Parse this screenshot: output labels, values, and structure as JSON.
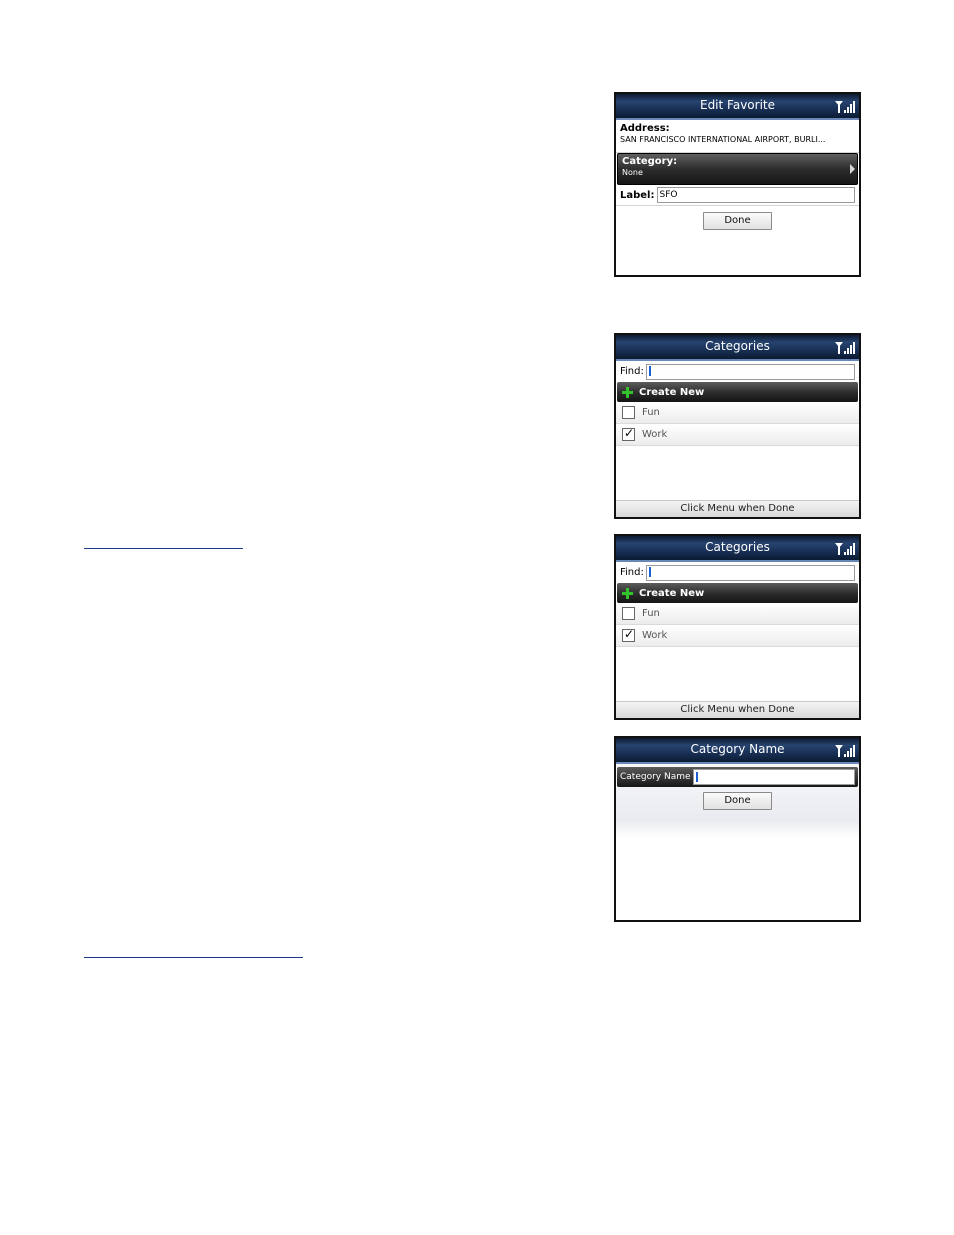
{
  "screens": {
    "edit_favorite": {
      "title": "Edit Favorite",
      "address_label": "Address:",
      "address_value": "SAN FRANCISCO INTERNATIONAL AIRPORT, BURLI...",
      "category_label": "Category:",
      "category_value": "None",
      "label_label": "Label:",
      "label_value": "SFO",
      "done_button": "Done"
    },
    "categories_1": {
      "title": "Categories",
      "find_label": "Find:",
      "create_new": "Create New",
      "items": [
        {
          "label": "Fun",
          "checked": false
        },
        {
          "label": "Work",
          "checked": true
        }
      ],
      "footer": "Click Menu when Done"
    },
    "categories_2": {
      "title": "Categories",
      "find_label": "Find:",
      "create_new": "Create New",
      "items": [
        {
          "label": "Fun",
          "checked": false
        },
        {
          "label": "Work",
          "checked": true
        }
      ],
      "footer": "Click Menu when Done"
    },
    "category_name": {
      "title": "Category Name",
      "field_label": "Category Name",
      "done_button": "Done"
    }
  }
}
